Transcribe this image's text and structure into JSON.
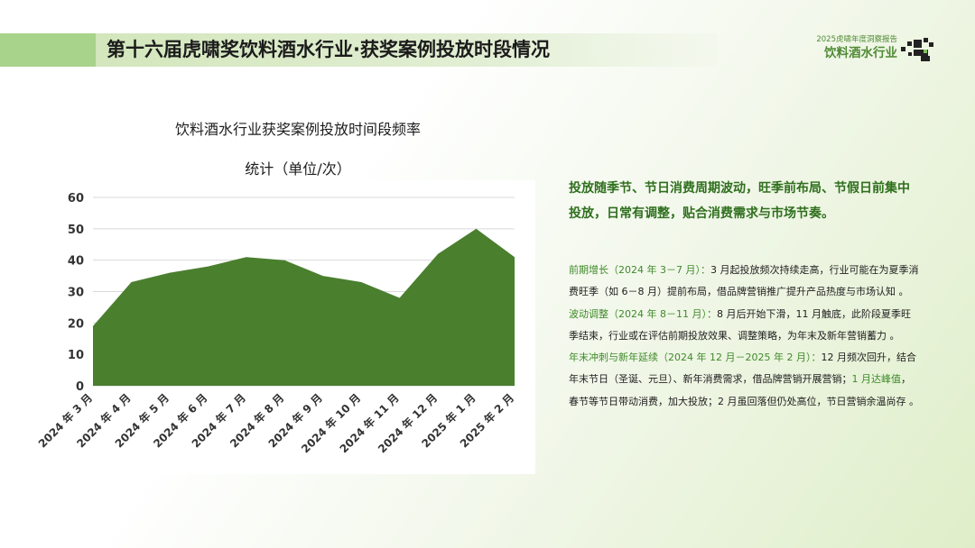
{
  "header": {
    "title": "第十六届虎啸奖饮料酒水行业·获奖案例投放时段情况",
    "brand_sub": "2025虎啸年度洞察报告",
    "brand_main": "饮料酒水行业",
    "logo_icon": "pixel-tiger-logo-icon"
  },
  "chart_title_line1": "饮料酒水行业获奖案例投放时间段频率",
  "chart_title_line2": "统计（单位/次）",
  "chart_data": {
    "type": "area",
    "title": "饮料酒水行业获奖案例投放时间段频率统计（单位/次）",
    "categories": [
      "2024 年 3 月",
      "2024 年 4 月",
      "2024 年 5 月",
      "2024 年 6 月",
      "2024 年 7 月",
      "2024 年 8 月",
      "2024 年 9 月",
      "2024 年 10 月",
      "2024 年 11 月",
      "2024 年 12 月",
      "2025 年 1 月",
      "2025 年 2 月"
    ],
    "values": [
      19,
      33,
      36,
      38,
      41,
      40,
      35,
      33,
      28,
      42,
      50,
      41
    ],
    "ylim": [
      0,
      60
    ],
    "yticks": [
      0,
      10,
      20,
      30,
      40,
      50,
      60
    ],
    "grid": true,
    "legend": "none",
    "color": "#4a7f2e"
  },
  "summary": "投放随季节、节日消费周期波动，旺季前布局、节假日前集中投放，日常有调整，贴合消费需求与市场节奏。",
  "sections": [
    {
      "heading": "前期增长（2024 年 3－7 月）：",
      "body": "3 月起投放频次持续走高，行业可能在为夏季消费旺季（如 6－8 月）提前布局，借品牌营销推广提升产品热度与市场认知 。"
    },
    {
      "heading": "波动调整（2024 年 8－11 月）：",
      "body": "8 月后开始下滑，11 月触底，此阶段夏季旺季结束，行业或在评估前期投放效果、调整策略，为年末及新年营销蓄力 。"
    },
    {
      "heading": "年末冲刺与新年延续（2024 年 12 月－2025 年 2 月）：",
      "body_a": "12 月频次回升，结合年末节日（圣诞、元旦）、新年消费需求，借品牌营销开展营销；",
      "highlight": "1 月达峰值",
      "body_b": "，春节等节日带动消费，加大投放；2 月虽回落但仍处高位，节日营销余温尚存 。"
    }
  ]
}
